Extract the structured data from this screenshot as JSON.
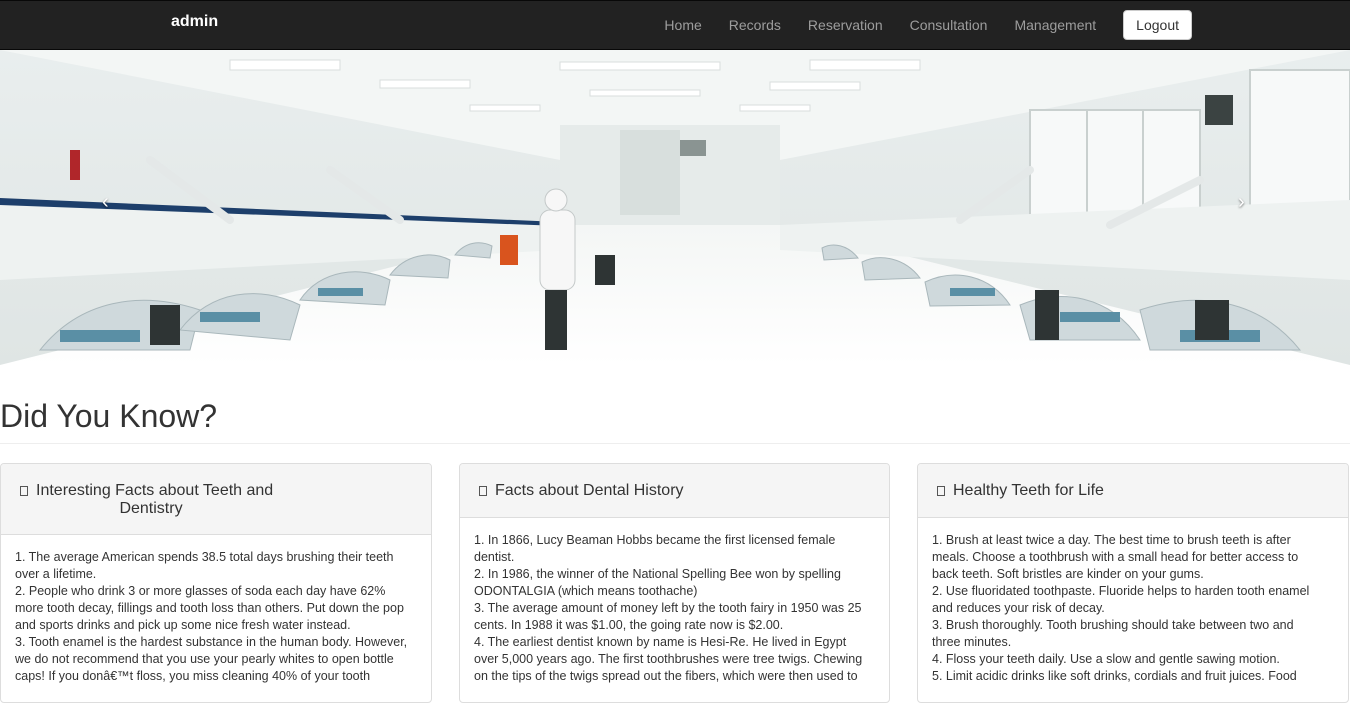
{
  "navbar": {
    "brand": "admin",
    "items": [
      "Home",
      "Records",
      "Reservation",
      "Consultation",
      "Management"
    ],
    "logout_label": "Logout"
  },
  "carousel": {
    "prev_label": "‹",
    "next_label": "›"
  },
  "main": {
    "headline": "Did You Know?"
  },
  "panels": [
    {
      "title_line1": "Interesting Facts about Teeth and",
      "title_line2": "Dentistry",
      "lines": [
        "1. The average American spends 38.5 total days brushing their teeth",
        "over a lifetime.",
        "2. People who drink 3 or more glasses of soda each day have 62%",
        "more tooth decay, fillings and tooth loss than others. Put down the pop",
        "and sports drinks and pick up some nice fresh water instead.",
        "3. Tooth enamel is the hardest substance in the human body. However,",
        "we do not recommend that you use your pearly whites to open bottle",
        "caps! If you donâ€™t floss, you miss cleaning 40% of your tooth"
      ]
    },
    {
      "title_line1": "Facts about Dental History",
      "lines": [
        "1. In 1866, Lucy Beaman Hobbs became the first licensed female",
        "dentist.",
        "2. In 1986, the winner of the National Spelling Bee won by spelling",
        "ODONTALGIA (which means toothache)",
        "3. The average amount of money left by the tooth fairy in 1950 was 25",
        "cents. In 1988 it was $1.00, the going rate now is $2.00.",
        "4. The earliest dentist known by name is Hesi-Re. He lived in Egypt",
        "over 5,000 years ago. The first toothbrushes were tree twigs. Chewing",
        "on the tips of the twigs spread out the fibers, which were then used to"
      ]
    },
    {
      "title_line1": "Healthy Teeth for Life",
      "lines": [
        "1. Brush at least twice a day. The best time to brush teeth is after",
        "meals. Choose a toothbrush with a small head for better access to",
        "back teeth. Soft bristles are kinder on your gums.",
        "2. Use fluoridated toothpaste. Fluoride helps to harden tooth enamel",
        "and reduces your risk of decay.",
        "3. Brush thoroughly. Tooth brushing should take between two and",
        "three minutes.",
        "4. Floss your teeth daily. Use a slow and gentle sawing motion.",
        "5. Limit acidic drinks like soft drinks, cordials and fruit juices. Food"
      ]
    }
  ]
}
